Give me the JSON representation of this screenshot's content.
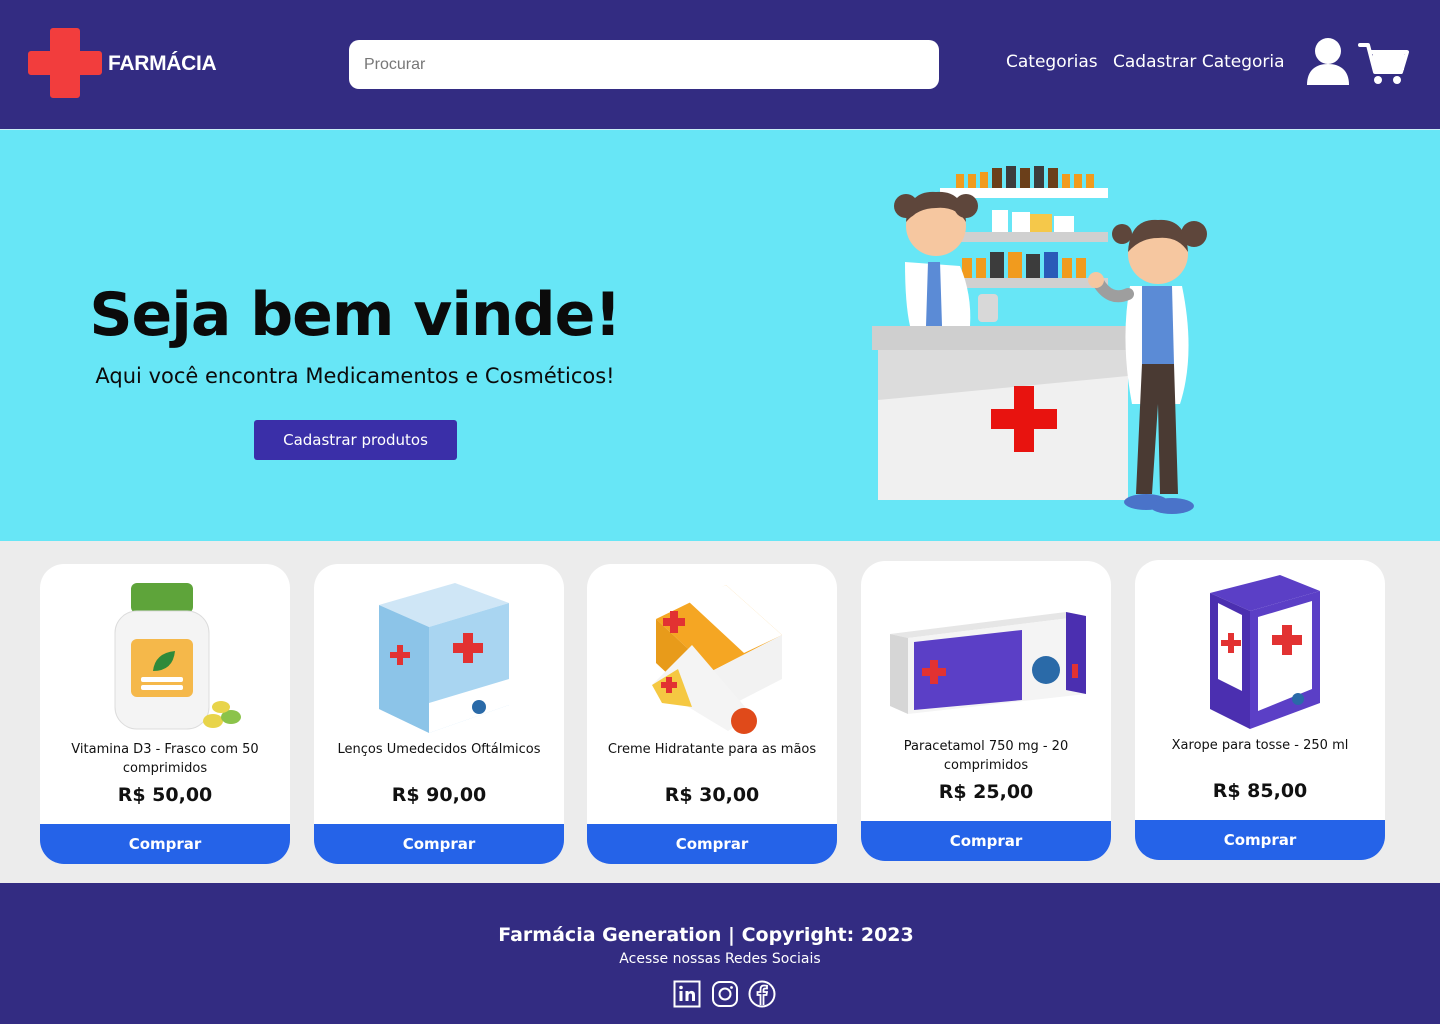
{
  "header": {
    "logo_text": "FARMÁCIA",
    "search_placeholder": "Procurar",
    "nav": {
      "categories": "Categorias",
      "register_category": "Cadastrar Categoria"
    },
    "icons": {
      "logo": "red-cross-icon",
      "user": "user-icon",
      "cart": "cart-icon"
    }
  },
  "hero": {
    "title": "Seja bem vinde!",
    "subtitle": "Aqui você encontra Medicamentos e Cosméticos!",
    "button": "Cadastrar produtos"
  },
  "products": [
    {
      "name": "Vitamina D3 - Frasco com 50 comprimidos",
      "price": "R$ 50,00",
      "button": "Comprar"
    },
    {
      "name": "Lenços Umedecidos Oftálmicos",
      "price": "R$ 90,00",
      "button": "Comprar"
    },
    {
      "name": "Creme Hidratante para as mãos",
      "price": "R$ 30,00",
      "button": "Comprar"
    },
    {
      "name": "Paracetamol 750 mg - 20 comprimidos",
      "price": "R$ 25,00",
      "button": "Comprar"
    },
    {
      "name": "Xarope para tosse - 250 ml",
      "price": "R$ 85,00",
      "button": "Comprar"
    }
  ],
  "footer": {
    "title": "Farmácia Generation | Copyright: 2023",
    "subtitle": "Acesse nossas Redes Sociais",
    "social": [
      "linkedin-icon",
      "instagram-icon",
      "facebook-icon"
    ]
  },
  "colors": {
    "header_bg": "#332c82",
    "hero_bg": "#67e6f6",
    "accent_button": "#3a2fa8",
    "buy_button": "#2563e8",
    "logo_red": "#f03a3a",
    "products_bg": "#ececec"
  }
}
